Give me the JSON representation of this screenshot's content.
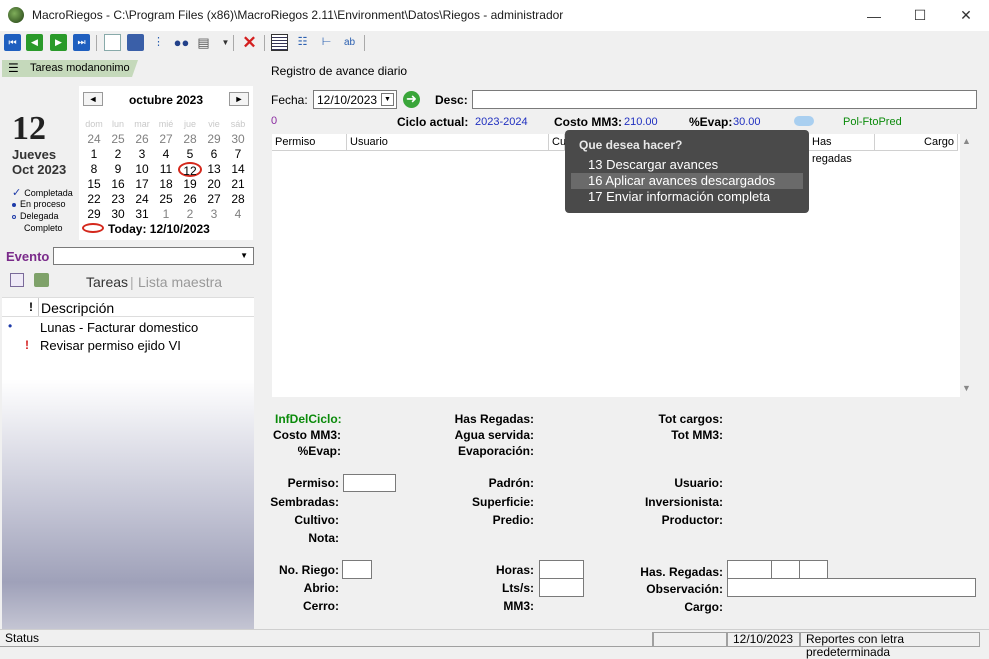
{
  "window": {
    "title": "MacroRiegos - C:\\Program Files (x86)\\MacroRiegos 2.11\\Environment\\Datos\\Riegos - administrador",
    "minimize": "—",
    "maximize": "☐",
    "close": "✕"
  },
  "sidebar": {
    "tab_label": "Tareas modanonimo",
    "big_day": "12",
    "weekday": "Jueves",
    "month_year": "Oct 2023",
    "legend": [
      "Completada",
      "En proceso",
      "Delegada",
      "Completo"
    ],
    "calendar": {
      "prev": "◄",
      "next": "►",
      "title": "octubre 2023",
      "dows": [
        "dom",
        "lun",
        "mar",
        "mié",
        "jue",
        "vie",
        "sáb"
      ],
      "days": [
        "24",
        "25",
        "26",
        "27",
        "28",
        "29",
        "30",
        "1",
        "2",
        "3",
        "4",
        "5",
        "6",
        "7",
        "8",
        "9",
        "10",
        "11",
        "12",
        "13",
        "14",
        "15",
        "16",
        "17",
        "18",
        "19",
        "20",
        "21",
        "22",
        "23",
        "24",
        "25",
        "26",
        "27",
        "28",
        "29",
        "30",
        "31",
        "1",
        "2",
        "3",
        "4"
      ],
      "today_label": "Today: 12/10/2023"
    },
    "evento_label": "Evento",
    "tab_tareas": "Tareas",
    "tab_sep": "|",
    "tab_lista": "Lista maestra",
    "col_flag": "!",
    "col_desc": "Descripción",
    "tasks": [
      {
        "flag": "•",
        "desc": "Lunas - Facturar domestico"
      },
      {
        "flag": "!",
        "desc": "Revisar permiso ejido VI"
      }
    ]
  },
  "main": {
    "heading": "Registro de avance diario",
    "fecha_label": "Fecha:",
    "fecha_value": "12/10/2023",
    "desc_label": "Desc:",
    "zero": "0",
    "ciclo_label": "Ciclo actual:",
    "ciclo_value": "2023-2024",
    "costo_label": "Costo MM3:",
    "costo_value": "210.00",
    "evap_label": "%Evap:",
    "evap_value": "30.00",
    "pol_label": "Pol-FtoPred",
    "grid_cols": [
      "Permiso",
      "Usuario",
      "Cu",
      "Has regadas",
      "Cargo"
    ],
    "details": {
      "infdelciclo": "InfDelCiclo:",
      "costo_mm3": "Costo MM3:",
      "evap": "%Evap:",
      "has_regadas": "Has Regadas:",
      "agua_servida": "Agua servida:",
      "evaporacion": "Evaporación:",
      "tot_cargos": "Tot cargos:",
      "tot_mm3": "Tot MM3:",
      "permiso": "Permiso:",
      "sembradas": "Sembradas:",
      "cultivo": "Cultivo:",
      "nota": "Nota:",
      "padron": "Padrón:",
      "superficie": "Superficie:",
      "predio": "Predio:",
      "usuario": "Usuario:",
      "inversionista": "Inversionista:",
      "productor": "Productor:",
      "no_riego": "No. Riego:",
      "abrio": "Abrio:",
      "cerro": "Cerro:",
      "horas": "Horas:",
      "lts_s": "Lts/s:",
      "mm3": "MM3:",
      "has_regadas2": "Has. Regadas:",
      "observacion": "Observación:",
      "cargo": "Cargo:"
    }
  },
  "popup": {
    "title": "Que desea hacer?",
    "items": [
      "13 Descargar avances",
      "16 Aplicar avances descargados",
      "17 Enviar información completa"
    ]
  },
  "status": {
    "text": "Status",
    "date": "12/10/2023",
    "report": "Reportes con letra predeterminada"
  },
  "colors": {
    "accent_green": "#0a8a0a",
    "value_blue": "#2030c0",
    "today_red": "#d4281c",
    "popup_bg": "#4a4a4a"
  }
}
